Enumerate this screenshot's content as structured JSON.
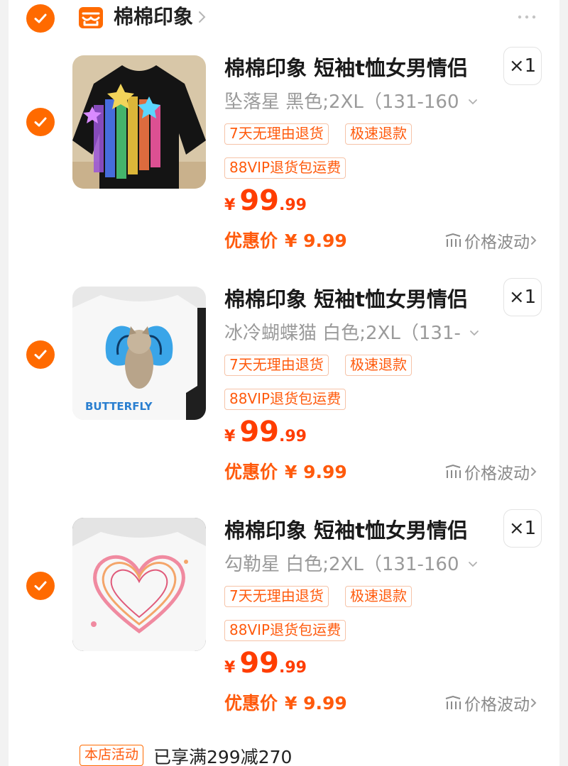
{
  "shop": {
    "name": "棉棉印象",
    "selected": true
  },
  "items": [
    {
      "title": "棉棉印象 短袖t恤女男情侣",
      "sku": "坠落星 黑色;2XL（131-160",
      "qty": "×1",
      "tags": [
        "7天无理由退货",
        "极速退款",
        "88VIP退货包运费"
      ],
      "price_symbol": "¥",
      "price_int": "99",
      "price_dec": ".99",
      "discount_label": "优惠价",
      "discount_value": "¥ 9.99",
      "trend_label": "价格波动",
      "image": "black-tshirt-falling-stars"
    },
    {
      "title": "棉棉印象 短袖t恤女男情侣",
      "sku": "冰冷蝴蝶猫 白色;2XL（131-",
      "qty": "×1",
      "tags": [
        "7天无理由退货",
        "极速退款",
        "88VIP退货包运费"
      ],
      "price_symbol": "¥",
      "price_int": "99",
      "price_dec": ".99",
      "discount_label": "优惠价",
      "discount_value": "¥ 9.99",
      "trend_label": "价格波动",
      "image": "white-tshirt-butterfly-cat",
      "image_text": "BUTTERFLY"
    },
    {
      "title": "棉棉印象 短袖t恤女男情侣",
      "sku": "勾勒星 白色;2XL（131-160",
      "qty": "×1",
      "tags": [
        "7天无理由退货",
        "极速退款",
        "88VIP退货包运费"
      ],
      "price_symbol": "¥",
      "price_int": "99",
      "price_dec": ".99",
      "discount_label": "优惠价",
      "discount_value": "¥ 9.99",
      "trend_label": "价格波动",
      "image": "white-tshirt-pink-heart"
    }
  ],
  "promo": {
    "badge": "本店活动",
    "text": "已享满299减270"
  },
  "colors": {
    "accent": "#ff6a00",
    "price": "#ff3d00",
    "tag_border": "#f6c3a8",
    "muted": "#9a9a9a"
  }
}
